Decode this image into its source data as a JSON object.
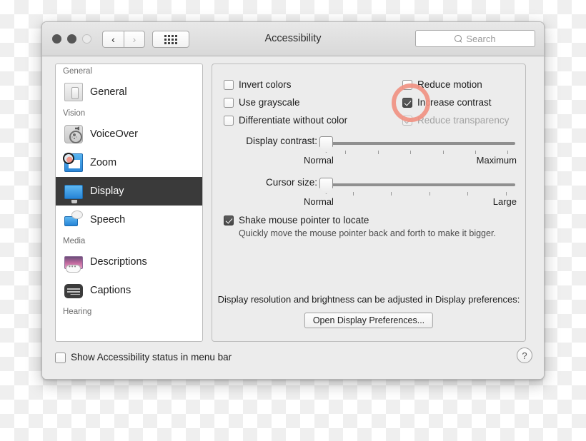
{
  "window": {
    "title": "Accessibility",
    "traffic_lights": [
      "close-button",
      "minimize-button",
      "zoom-button"
    ],
    "nav": {
      "back": "‹",
      "forward": "›",
      "grid": "grid-view-button"
    },
    "search": {
      "placeholder": "Search",
      "value": "",
      "icon": "search-icon"
    }
  },
  "sidebar": {
    "groups": [
      {
        "header": "General",
        "items": [
          {
            "label": "General",
            "icon": "general-icon",
            "selected": false
          }
        ]
      },
      {
        "header": "Vision",
        "items": [
          {
            "label": "VoiceOver",
            "icon": "voiceover-icon",
            "selected": false
          },
          {
            "label": "Zoom",
            "icon": "zoom-icon",
            "selected": false
          },
          {
            "label": "Display",
            "icon": "display-icon",
            "selected": true
          },
          {
            "label": "Speech",
            "icon": "speech-icon",
            "selected": false
          }
        ]
      },
      {
        "header": "Media",
        "items": [
          {
            "label": "Descriptions",
            "icon": "descriptions-icon",
            "selected": false
          },
          {
            "label": "Captions",
            "icon": "captions-icon",
            "selected": false
          }
        ]
      },
      {
        "header": "Hearing",
        "items": []
      }
    ]
  },
  "panel": {
    "checkboxes_left": [
      {
        "label": "Invert colors",
        "checked": false,
        "disabled": false
      },
      {
        "label": "Use grayscale",
        "checked": false,
        "disabled": false
      },
      {
        "label": "Differentiate without color",
        "checked": false,
        "disabled": false
      }
    ],
    "checkboxes_right": [
      {
        "label": "Reduce motion",
        "checked": false,
        "disabled": false
      },
      {
        "label": "Increase contrast",
        "checked": true,
        "disabled": false
      },
      {
        "label": "Reduce transparency",
        "checked": true,
        "disabled": true
      }
    ],
    "sliders": [
      {
        "caption": "Display contrast:",
        "min_label": "Normal",
        "max_label": "Maximum",
        "value": 0,
        "tick_count": 6
      },
      {
        "caption": "Cursor size:",
        "min_label": "Normal",
        "max_label": "Large",
        "value": 0,
        "tick_count": 5
      }
    ],
    "shake": {
      "label": "Shake mouse pointer to locate",
      "checked": true,
      "description": "Quickly move the mouse pointer back and forth to make it bigger."
    },
    "bottom_note": "Display resolution and brightness can be adjusted in Display preferences:",
    "open_display_button": "Open Display Preferences..."
  },
  "footer": {
    "menu_bar_checkbox": {
      "label": "Show Accessibility status in menu bar",
      "checked": false
    },
    "help_button": "?"
  },
  "annotation": {
    "target": "increase-contrast-checkbox",
    "color": "#f09182",
    "shape": "circle"
  }
}
